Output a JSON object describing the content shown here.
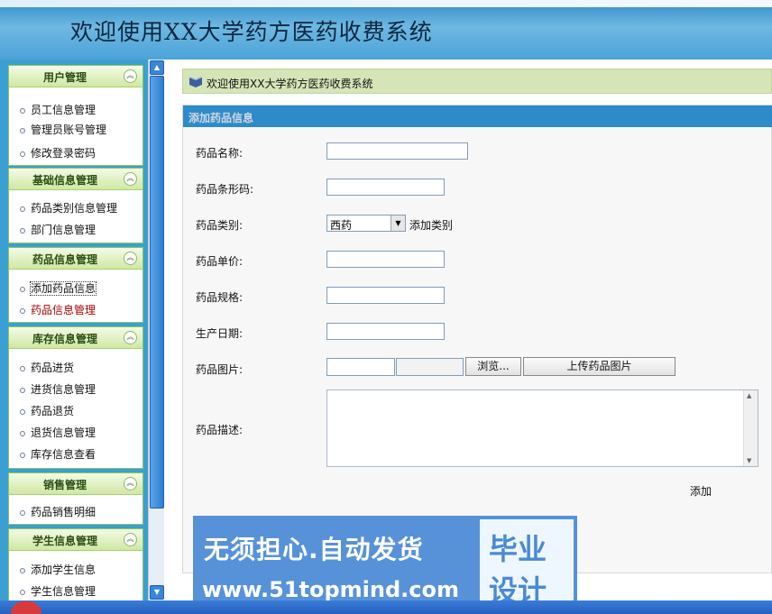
{
  "header": {
    "title": "欢迎使用XX大学药方医药收费系统"
  },
  "sidebar": {
    "groups": [
      {
        "title": "用户管理",
        "items": [
          "员工信息管理",
          "管理员账号管理",
          "修改登录密码"
        ]
      },
      {
        "title": "基础信息管理",
        "items": [
          "药品类别信息管理",
          "部门信息管理"
        ]
      },
      {
        "title": "药品信息管理",
        "items": [
          "添加药品信息",
          "药品信息管理"
        ]
      },
      {
        "title": "库存信息管理",
        "items": [
          "药品进货",
          "进货信息管理",
          "药品退货",
          "退货信息管理",
          "库存信息查看"
        ]
      },
      {
        "title": "销售管理",
        "items": [
          "药品销售明细"
        ]
      },
      {
        "title": "学生信息管理",
        "items": [
          "添加学生信息",
          "学生信息管理"
        ]
      }
    ],
    "active_item": "药品信息管理",
    "focused_item": "添加药品信息",
    "collapse_glyph": "︽"
  },
  "breadcrumb": {
    "text": "欢迎使用XX大学药方医药收费系统",
    "icon": "book-icon"
  },
  "form": {
    "title": "添加药品信息",
    "fields": {
      "name": {
        "label": "药品名称:",
        "value": ""
      },
      "barcode": {
        "label": "药品条形码:",
        "value": ""
      },
      "category": {
        "label": "药品类别:",
        "value": "西药",
        "add_link": "添加类别"
      },
      "price": {
        "label": "药品单价:",
        "value": ""
      },
      "spec": {
        "label": "药品规格:",
        "value": ""
      },
      "prod_date": {
        "label": "生产日期:",
        "value": ""
      },
      "image": {
        "label": "药品图片:",
        "browse_label": "浏览...",
        "upload_label": "上传药品图片"
      },
      "desc": {
        "label": "药品描述:",
        "value": ""
      }
    },
    "submit_label": "添加"
  },
  "watermark": {
    "line1": "无须担心.自动发货",
    "line2": "www.51topmind.com",
    "badge_line1": "毕业",
    "badge_line2": "设计"
  },
  "colors": {
    "header": "#4aa3d8",
    "sidebar_bg": "#3b9fd1",
    "menu_head": "#cfe8a3",
    "panel_title": "#2d8bc9",
    "breadcrumb_bg": "#d6e5b8"
  }
}
